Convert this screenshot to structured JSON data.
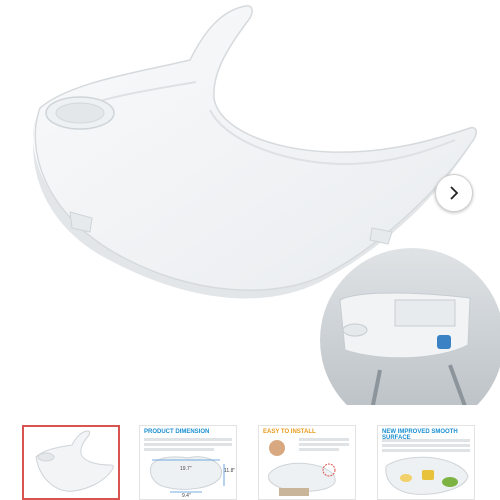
{
  "gallery": {
    "main_image": "baby-high-chair-tray-product-image",
    "next_button_icon": "chevron-right-icon",
    "thumbnails": [
      {
        "title": "",
        "selected": true
      },
      {
        "title": "PRODUCT DIMENSION",
        "dims": [
          "19.7\"",
          "11.8\"",
          "9.4\""
        ],
        "selected": false
      },
      {
        "title": "EASY TO INSTALL",
        "selected": false
      },
      {
        "title": "NEW IMPROVED SMOOTH SURFACE",
        "selected": false
      }
    ]
  },
  "colors": {
    "accent": "#d9534f",
    "title_blue": "#1a8fd1",
    "title_orange": "#e89a1b",
    "tray": "#f4f6f8"
  }
}
